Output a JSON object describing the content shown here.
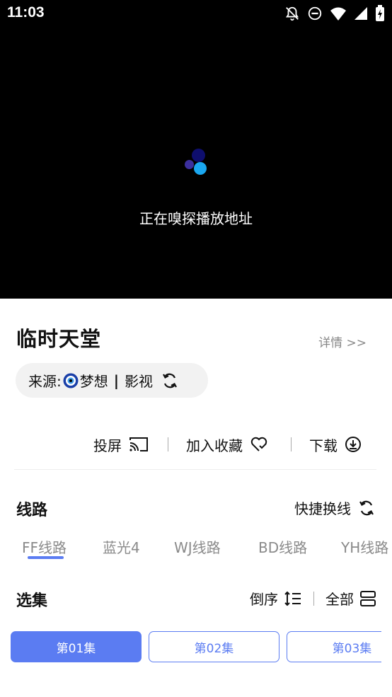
{
  "status_bar": {
    "time": "11:03",
    "icons": [
      "bell-off-icon",
      "do-not-disturb-icon",
      "wifi-icon",
      "signal-icon",
      "battery-charging-icon"
    ]
  },
  "player": {
    "loading_text": "正在嗅探播放地址",
    "loader_colors": [
      "#0e0e6e",
      "#3b2f9e",
      "#1aa7f0"
    ]
  },
  "video": {
    "title": "临时天堂",
    "detail_link": "详情 >>",
    "source_label": "来源:",
    "source_name": "梦想",
    "source_separator": "|",
    "source_category": "影视"
  },
  "actions": {
    "cast_label": "投屏",
    "favorite_label": "加入收藏",
    "download_label": "下载"
  },
  "routes": {
    "title": "线路",
    "quick_switch_label": "快捷换线",
    "tabs": [
      {
        "label": "FF线路",
        "active": true
      },
      {
        "label": "蓝光4",
        "active": false
      },
      {
        "label": "WJ线路",
        "active": false
      },
      {
        "label": "BD线路",
        "active": false
      },
      {
        "label": "YH线路",
        "active": false
      }
    ]
  },
  "episodes": {
    "title": "选集",
    "reverse_label": "倒序",
    "all_label": "全部",
    "items": [
      {
        "label": "第01集",
        "selected": true
      },
      {
        "label": "第02集",
        "selected": false
      },
      {
        "label": "第03集",
        "selected": false
      }
    ]
  },
  "colors": {
    "accent": "#5b7cf2",
    "player_bg": "#000000",
    "chip_bg": "#f2f2f2"
  }
}
